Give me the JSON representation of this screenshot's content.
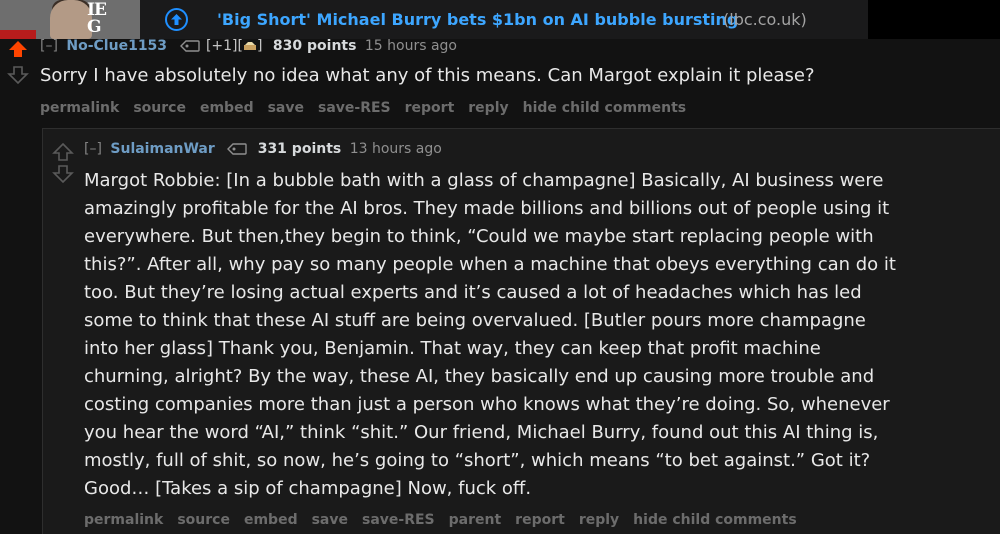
{
  "post": {
    "title": "'Big Short' Michael Burry bets $1bn on AI bubble bursting",
    "domain": "(lbc.co.uk)",
    "thumbnail_text": "IE\nG"
  },
  "comment": {
    "toggle": "[–]",
    "author": "No-Clue1153",
    "awards": "[+1][",
    "awards_end": "]",
    "points": "830 points",
    "time": "15 hours ago",
    "body": "Sorry I have absolutely no idea what any of this means. Can Margot explain it please?",
    "buttons": [
      "permalink",
      "source",
      "embed",
      "save",
      "save-RES",
      "report",
      "reply",
      "hide child comments"
    ]
  },
  "reply": {
    "toggle": "[–]",
    "author": "SulaimanWar",
    "points": "331 points",
    "time": "13 hours ago",
    "body_lines": [
      "Margot Robbie: [In a bubble bath with a glass of champagne] Basically, AI business were",
      "amazingly profitable for the AI bros. They made billions and billions out of people using it",
      "everywhere. But then,they begin to think, “Could we maybe start replacing people with",
      "this?”. After all, why pay so many people when a machine that obeys everything can do it",
      "too. But they’re losing actual experts and it’s caused a lot of headaches which has led",
      "some to think that these AI stuff are being overvalued. [Butler pours more champagne",
      "into her glass] Thank you, Benjamin. That way, they can keep that profit machine",
      "churning, alright? By the way, these AI, they basically end up causing more trouble and",
      "costing companies more than just a person who knows what they’re doing. So, whenever",
      "you hear the word “AI,” think “shit.” Our friend, Michael Burry, found out this AI thing is,",
      "mostly, full of shit, so now, he’s going to “short”, which means “to bet against.” Got it?",
      "Good… [Takes a sip of champagne] Now, fuck off."
    ],
    "buttons": [
      "permalink",
      "source",
      "embed",
      "save",
      "save-RES",
      "parent",
      "report",
      "reply",
      "hide child comments"
    ]
  },
  "colors": {
    "background": "#121212",
    "link_blue": "#3da6ff",
    "author_blue": "#6e9cc4",
    "upvoted_orange": "#ff4500",
    "muted_button": "#6c6c6c"
  },
  "icons": {
    "post_upvote": "circle-up-arrow-icon",
    "upvote": "up-arrow-icon",
    "downvote": "down-arrow-icon",
    "flair": "speech-tag-icon",
    "award": "award-icon"
  }
}
